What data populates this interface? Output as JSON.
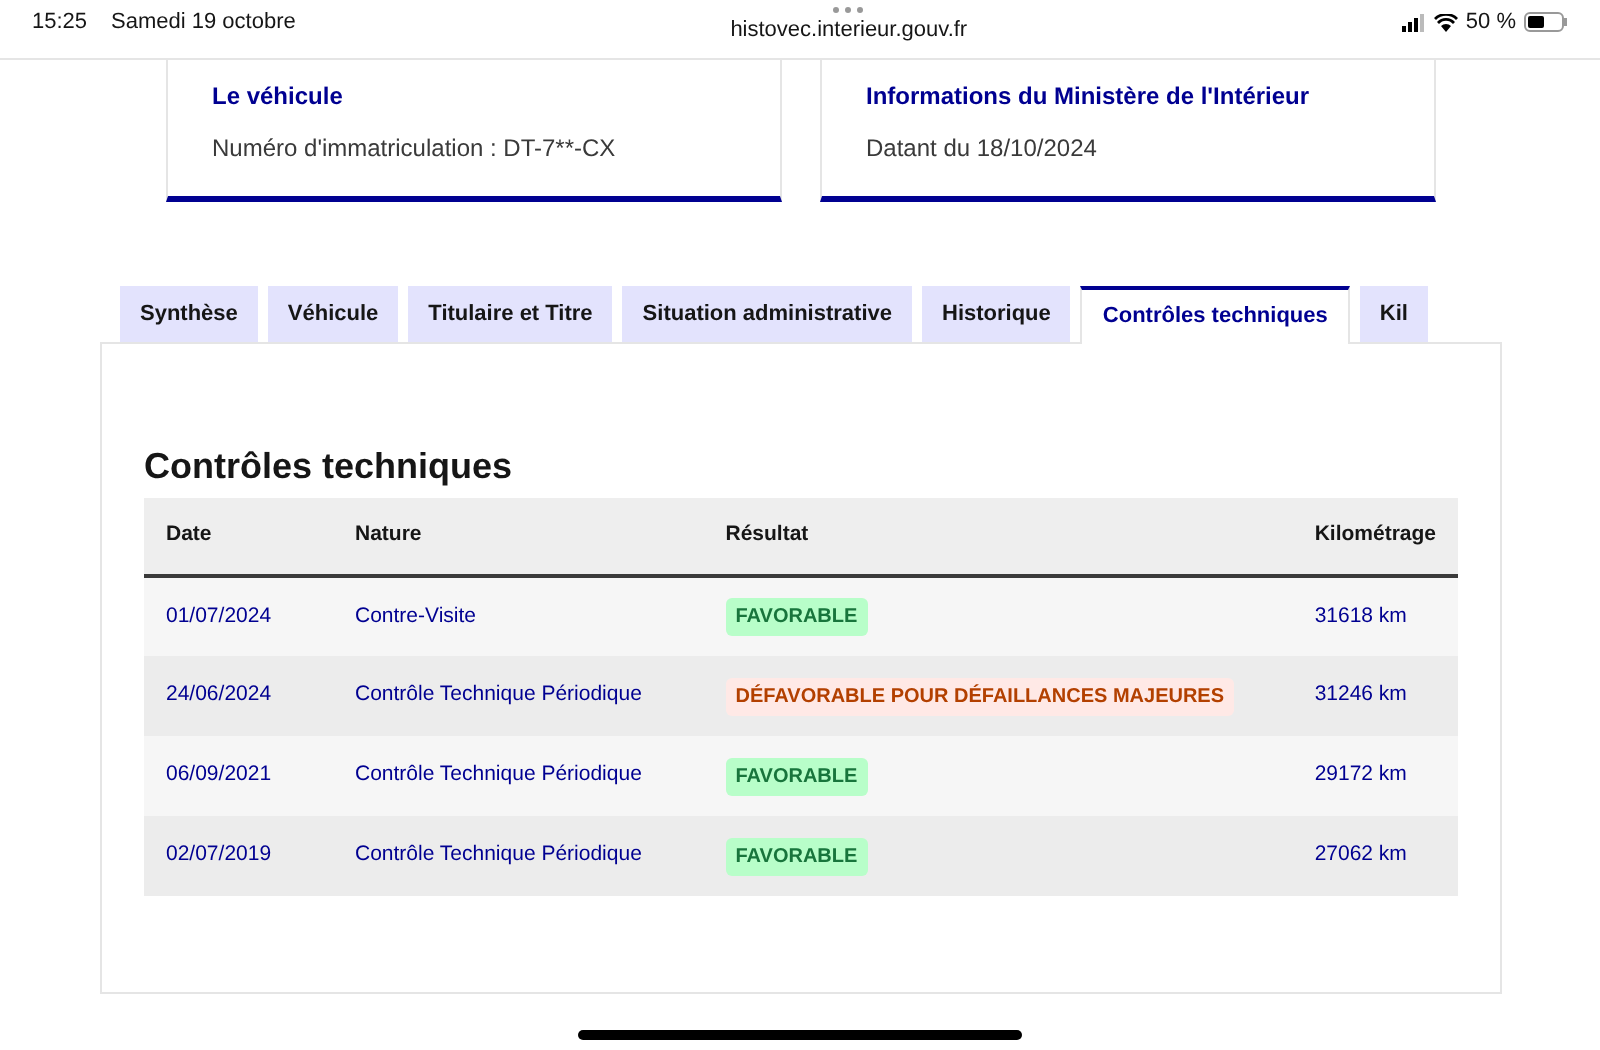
{
  "status_bar": {
    "time": "15:25",
    "date": "Samedi 19 octobre",
    "url": "histovec.interieur.gouv.fr",
    "battery": "50 %"
  },
  "cards": [
    {
      "title": "Le véhicule",
      "text": "Numéro d'immatriculation : DT-7**-CX"
    },
    {
      "title": "Informations du Ministère de l'Intérieur",
      "text": "Datant du 18/10/2024"
    }
  ],
  "tabs": [
    {
      "label": "Synthèse",
      "selected": false
    },
    {
      "label": "Véhicule",
      "selected": false
    },
    {
      "label": "Titulaire et Titre",
      "selected": false
    },
    {
      "label": "Situation administrative",
      "selected": false
    },
    {
      "label": "Historique",
      "selected": false
    },
    {
      "label": "Contrôles techniques",
      "selected": true
    },
    {
      "label": "Kil",
      "selected": false
    }
  ],
  "section_title": "Contrôles techniques",
  "table": {
    "columns": [
      "Date",
      "Nature",
      "Résultat",
      "Kilométrage"
    ],
    "rows": [
      {
        "date": "01/07/2024",
        "nature": "Contre-Visite",
        "result": {
          "label": "FAVORABLE",
          "kind": "success"
        },
        "km": "31618 km"
      },
      {
        "date": "24/06/2024",
        "nature": "Contrôle Technique Périodique",
        "result": {
          "label": "DÉFAVORABLE POUR DÉFAILLANCES MAJEURES",
          "kind": "error"
        },
        "km": "31246 km"
      },
      {
        "date": "06/09/2021",
        "nature": "Contrôle Technique Périodique",
        "result": {
          "label": "FAVORABLE",
          "kind": "success"
        },
        "km": "29172 km"
      },
      {
        "date": "02/07/2019",
        "nature": "Contrôle Technique Périodique",
        "result": {
          "label": "FAVORABLE",
          "kind": "success"
        },
        "km": "27062 km"
      }
    ]
  }
}
